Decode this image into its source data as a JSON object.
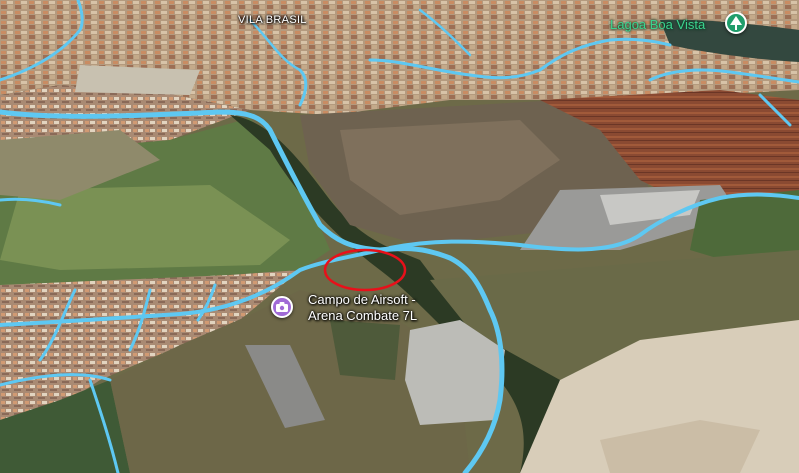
{
  "map": {
    "labels": {
      "neighborhood": "VILA BRASIL",
      "lake": "Lagoa Boa Vista",
      "poi_line1": "Campo de Airsoft -",
      "poi_line2": "Arena Combate 7L"
    },
    "icons": {
      "poi": "camera-pin-icon",
      "park": "tree-pin-icon"
    },
    "colors": {
      "road_highlight": "#5ec8f2",
      "annotation_circle": "#e8101a",
      "poi_pin": "#a06ad6",
      "park_pin": "#1f9d6b",
      "lake_label": "#3bd38e"
    }
  }
}
